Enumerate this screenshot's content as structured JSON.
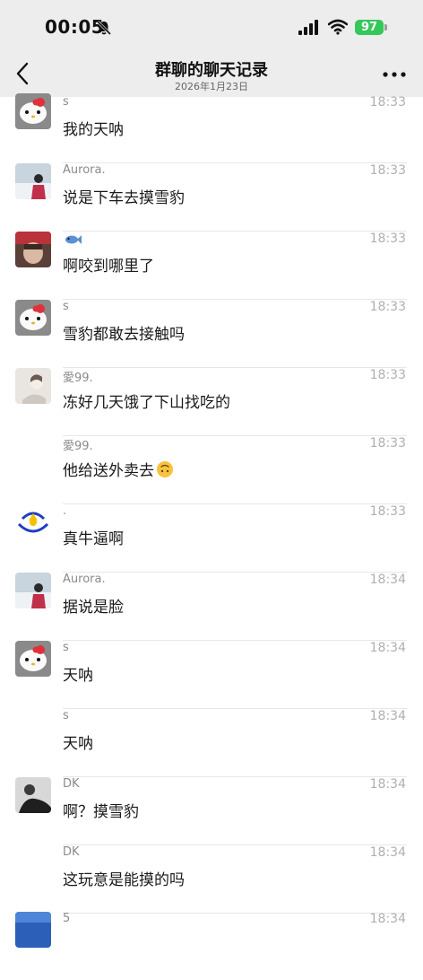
{
  "status_bar": {
    "time": "00:05",
    "battery": "97"
  },
  "header": {
    "title": "群聊的聊天记录",
    "subtitle": "2026年1月23日"
  },
  "messages": [
    {
      "sender": "s",
      "time": "18:33",
      "text": "我的天呐"
    },
    {
      "sender": "Aurora.",
      "time": "18:33",
      "text": "说是下车去摸雪豹"
    },
    {
      "sender": "",
      "time": "18:33",
      "text": "啊咬到哪里了",
      "sender_icon": "fish-icon"
    },
    {
      "sender": "s",
      "time": "18:33",
      "text": "雪豹都敢去接触吗"
    },
    {
      "sender": "愛99.",
      "time": "18:33",
      "text": "冻好几天饿了下山找吃的"
    },
    {
      "sender": "愛99.",
      "time": "18:33",
      "text": "他给送外卖去",
      "emoji": "upside-down-face-icon"
    },
    {
      "sender": ".",
      "time": "18:33",
      "text": "真牛逼啊"
    },
    {
      "sender": "Aurora.",
      "time": "18:34",
      "text": "据说是脸"
    },
    {
      "sender": "s",
      "time": "18:34",
      "text": "天呐"
    },
    {
      "sender": "s",
      "time": "18:34",
      "text": "天呐"
    },
    {
      "sender": "DK",
      "time": "18:34",
      "text": "啊？摸雪豹"
    },
    {
      "sender": "DK",
      "time": "18:34",
      "text": "这玩意是能摸的吗"
    },
    {
      "sender": "5",
      "time": "18:34",
      "text": ""
    }
  ],
  "colors": {
    "battery_green": "#34c759",
    "header_bg": "#ededed",
    "separator": "#e7e7e7"
  }
}
